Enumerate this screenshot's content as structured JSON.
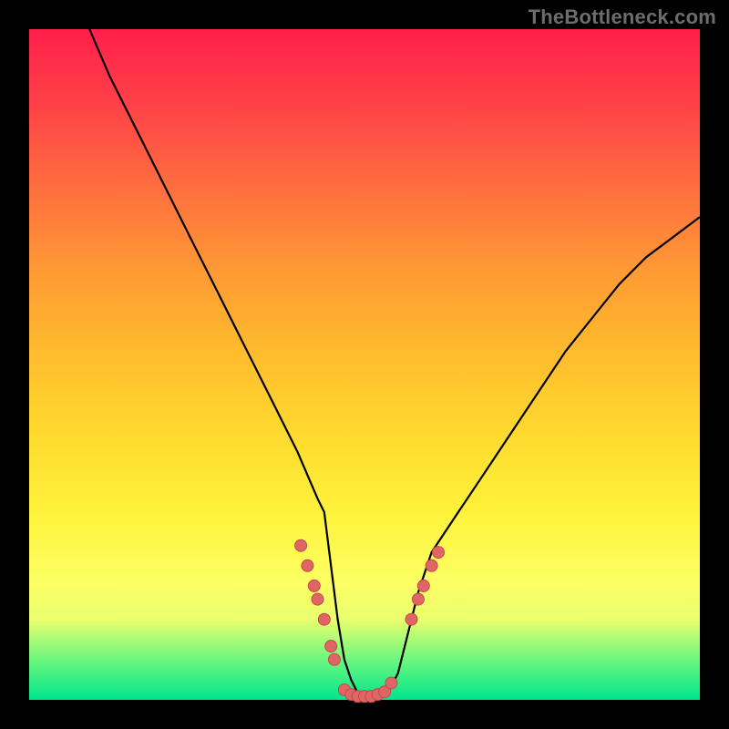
{
  "watermark": "TheBottleneck.com",
  "chart_data": {
    "type": "line",
    "title": "",
    "xlabel": "",
    "ylabel": "",
    "xlim": [
      0,
      100
    ],
    "ylim": [
      0,
      100
    ],
    "series": [
      {
        "name": "bottleneck-curve",
        "x": [
          9,
          12,
          16,
          20,
          24,
          28,
          32,
          36,
          40,
          43,
          44,
          45,
          46,
          47,
          48,
          49,
          50,
          51,
          52,
          53,
          54,
          55,
          56,
          58,
          60,
          64,
          68,
          72,
          76,
          80,
          84,
          88,
          92,
          96,
          100
        ],
        "y": [
          100,
          93,
          85,
          77,
          69,
          61,
          53,
          45,
          37,
          30,
          28,
          20,
          12,
          6,
          3,
          1,
          0,
          0,
          0,
          1,
          2,
          4,
          8,
          16,
          22,
          28,
          34,
          40,
          46,
          52,
          57,
          62,
          66,
          69,
          72
        ]
      }
    ],
    "markers": {
      "name": "highlight-dots",
      "points": [
        {
          "x": 40.5,
          "y": 23
        },
        {
          "x": 41.5,
          "y": 20
        },
        {
          "x": 42.5,
          "y": 17
        },
        {
          "x": 43,
          "y": 15
        },
        {
          "x": 44,
          "y": 12
        },
        {
          "x": 45,
          "y": 8
        },
        {
          "x": 45.5,
          "y": 6
        },
        {
          "x": 47,
          "y": 1.5
        },
        {
          "x": 48,
          "y": 0.8
        },
        {
          "x": 49,
          "y": 0.5
        },
        {
          "x": 50,
          "y": 0.5
        },
        {
          "x": 51,
          "y": 0.5
        },
        {
          "x": 52,
          "y": 0.8
        },
        {
          "x": 53,
          "y": 1.2
        },
        {
          "x": 54,
          "y": 2.5
        },
        {
          "x": 57,
          "y": 12
        },
        {
          "x": 58,
          "y": 15
        },
        {
          "x": 58.8,
          "y": 17
        },
        {
          "x": 60,
          "y": 20
        },
        {
          "x": 61,
          "y": 22
        }
      ]
    },
    "colors": {
      "curve": "#000000",
      "marker_fill": "#e06666",
      "marker_stroke": "#c24a4a",
      "gradient_top": "#ff1f4b",
      "gradient_bottom": "#00e58c"
    }
  }
}
